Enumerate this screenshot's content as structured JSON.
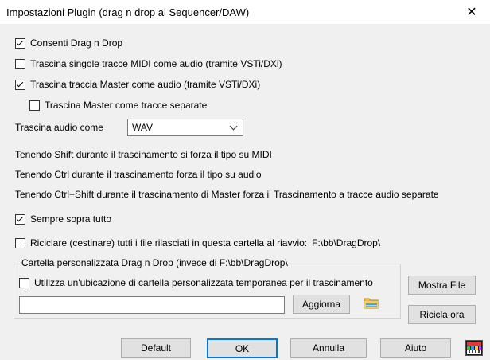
{
  "window": {
    "title": "Impostazioni Plugin (drag n drop al Sequencer/DAW)",
    "close_glyph": "✕"
  },
  "options": {
    "enable_drag": {
      "label": "Consenti Drag n Drop",
      "checked": true
    },
    "midi_as_audio": {
      "label": "Trascina singole tracce MIDI come audio (tramite VSTi/DXi)",
      "checked": false
    },
    "master_as_audio": {
      "label": "Trascina traccia Master come audio (tramite VSTi/DXi)",
      "checked": true
    },
    "master_separate": {
      "label": "Trascina Master come tracce separate",
      "checked": false
    }
  },
  "audio_format": {
    "label": "Trascina audio come",
    "value": "WAV"
  },
  "hints": [
    "Tenendo Shift durante il trascinamento si forza il tipo su MIDI",
    "Tenendo Ctrl durante il trascinamento forza il tipo su audio",
    "Tenendo Ctrl+Shift durante il trascinamento di Master forza il Trascinamento a tracce audio separate"
  ],
  "always_on_top": {
    "label": "Sempre sopra tutto",
    "checked": true
  },
  "recycle": {
    "label": "Riciclare (cestinare) tutti i file rilasciati in questa cartella al riavvio:",
    "path": "F:\\bb\\DragDrop\\",
    "checked": false
  },
  "custom_folder": {
    "group_title": "Cartella personalizzata Drag n Drop (invece di  F:\\bb\\DragDrop\\",
    "use_custom_label": "Utilizza un'ubicazione di cartella personalizzata temporanea per il trascinamento",
    "use_custom_checked": false,
    "path_value": "",
    "update_label": "Aggiorna",
    "folder_icon": "folder-icon"
  },
  "side_buttons": {
    "show_files": "Mostra File",
    "recycle_now": "Ricicla ora"
  },
  "footer": {
    "default": "Default",
    "ok": "OK",
    "cancel": "Annulla",
    "help": "Aiuto",
    "app_icon": "band-in-a-box-icon"
  },
  "colors": {
    "accent": "#0078d7",
    "background": "#f0f0f0"
  }
}
